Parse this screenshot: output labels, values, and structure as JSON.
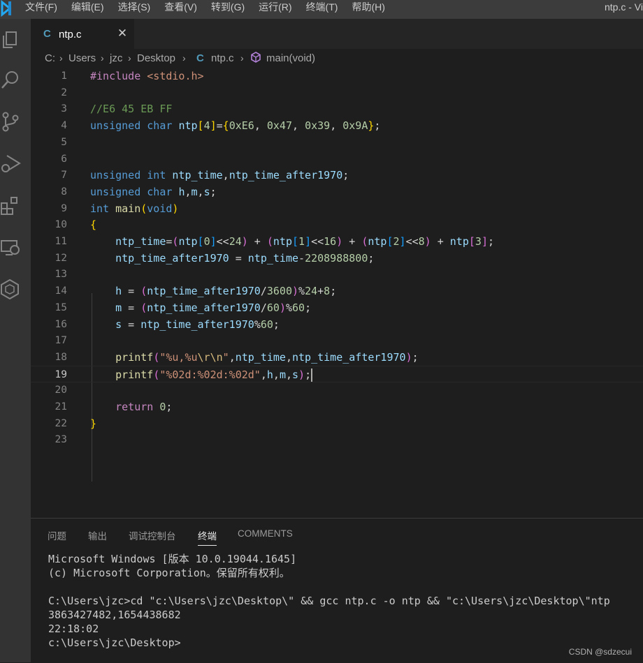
{
  "titlebar": {
    "menu": [
      "文件(F)",
      "编辑(E)",
      "选择(S)",
      "查看(V)",
      "转到(G)",
      "运行(R)",
      "终端(T)",
      "帮助(H)"
    ],
    "window_title": "ntp.c - Vi"
  },
  "activity_icons": [
    "explorer-icon",
    "search-icon",
    "source-control-icon",
    "run-debug-icon",
    "extensions-icon",
    "remote-explorer-icon",
    "cube-icon"
  ],
  "tab": {
    "lang_icon": "C",
    "name": "ntp.c",
    "close": "✕"
  },
  "breadcrumb": [
    "C:",
    "Users",
    "jzc",
    "Desktop",
    "ntp.c",
    "main(void)"
  ],
  "breadcrumb_lang_icon": "C",
  "editor": {
    "line_numbers": [
      "1",
      "2",
      "3",
      "4",
      "5",
      "6",
      "7",
      "8",
      "9",
      "10",
      "11",
      "12",
      "13",
      "14",
      "15",
      "16",
      "17",
      "18",
      "19",
      "20",
      "21",
      "22",
      "23"
    ],
    "current_line": 19,
    "lines": [
      [
        [
          "pp",
          "#include "
        ],
        [
          "str",
          "<stdio.h>"
        ]
      ],
      [],
      [
        [
          "cm",
          "//E6 45 EB FF"
        ]
      ],
      [
        [
          "kw",
          "unsigned char "
        ],
        [
          "vr",
          "ntp"
        ],
        [
          "b1",
          "["
        ],
        [
          "num",
          "4"
        ],
        [
          "b1",
          "]"
        ],
        [
          "pl",
          "="
        ],
        [
          "b1",
          "{"
        ],
        [
          "num",
          "0xE6"
        ],
        [
          "pl",
          ", "
        ],
        [
          "num",
          "0x47"
        ],
        [
          "pl",
          ", "
        ],
        [
          "num",
          "0x39"
        ],
        [
          "pl",
          ", "
        ],
        [
          "num",
          "0x9A"
        ],
        [
          "b1",
          "}"
        ],
        [
          "pl",
          ";"
        ]
      ],
      [],
      [],
      [
        [
          "kw",
          "unsigned int "
        ],
        [
          "vr",
          "ntp_time"
        ],
        [
          "pl",
          ","
        ],
        [
          "vr",
          "ntp_time_after1970"
        ],
        [
          "pl",
          ";"
        ]
      ],
      [
        [
          "kw",
          "unsigned char "
        ],
        [
          "vr",
          "h"
        ],
        [
          "pl",
          ","
        ],
        [
          "vr",
          "m"
        ],
        [
          "pl",
          ","
        ],
        [
          "vr",
          "s"
        ],
        [
          "pl",
          ";"
        ]
      ],
      [
        [
          "kw",
          "int "
        ],
        [
          "fn",
          "main"
        ],
        [
          "b1",
          "("
        ],
        [
          "kw",
          "void"
        ],
        [
          "b1",
          ")"
        ]
      ],
      [
        [
          "b1",
          "{"
        ]
      ],
      [
        [
          "pl",
          "    "
        ],
        [
          "vr",
          "ntp_time"
        ],
        [
          "pl",
          "="
        ],
        [
          "b2",
          "("
        ],
        [
          "vr",
          "ntp"
        ],
        [
          "b3",
          "["
        ],
        [
          "num",
          "0"
        ],
        [
          "b3",
          "]"
        ],
        [
          "pl",
          "<<"
        ],
        [
          "num",
          "24"
        ],
        [
          "b2",
          ")"
        ],
        [
          "pl",
          " + "
        ],
        [
          "b2",
          "("
        ],
        [
          "vr",
          "ntp"
        ],
        [
          "b3",
          "["
        ],
        [
          "num",
          "1"
        ],
        [
          "b3",
          "]"
        ],
        [
          "pl",
          "<<"
        ],
        [
          "num",
          "16"
        ],
        [
          "b2",
          ")"
        ],
        [
          "pl",
          " + "
        ],
        [
          "b2",
          "("
        ],
        [
          "vr",
          "ntp"
        ],
        [
          "b3",
          "["
        ],
        [
          "num",
          "2"
        ],
        [
          "b3",
          "]"
        ],
        [
          "pl",
          "<<"
        ],
        [
          "num",
          "8"
        ],
        [
          "b2",
          ")"
        ],
        [
          "pl",
          " + "
        ],
        [
          "vr",
          "ntp"
        ],
        [
          "b2",
          "["
        ],
        [
          "num",
          "3"
        ],
        [
          "b2",
          "]"
        ],
        [
          "pl",
          ";"
        ]
      ],
      [
        [
          "pl",
          "    "
        ],
        [
          "vr",
          "ntp_time_after1970"
        ],
        [
          "pl",
          " = "
        ],
        [
          "vr",
          "ntp_time"
        ],
        [
          "pl",
          "-"
        ],
        [
          "num",
          "2208988800"
        ],
        [
          "pl",
          ";"
        ]
      ],
      [],
      [
        [
          "pl",
          "    "
        ],
        [
          "vr",
          "h"
        ],
        [
          "pl",
          " = "
        ],
        [
          "b2",
          "("
        ],
        [
          "vr",
          "ntp_time_after1970"
        ],
        [
          "pl",
          "/"
        ],
        [
          "num",
          "3600"
        ],
        [
          "b2",
          ")"
        ],
        [
          "pl",
          "%"
        ],
        [
          "num",
          "24"
        ],
        [
          "pl",
          "+"
        ],
        [
          "num",
          "8"
        ],
        [
          "pl",
          ";"
        ]
      ],
      [
        [
          "pl",
          "    "
        ],
        [
          "vr",
          "m"
        ],
        [
          "pl",
          " = "
        ],
        [
          "b2",
          "("
        ],
        [
          "vr",
          "ntp_time_after1970"
        ],
        [
          "pl",
          "/"
        ],
        [
          "num",
          "60"
        ],
        [
          "b2",
          ")"
        ],
        [
          "pl",
          "%"
        ],
        [
          "num",
          "60"
        ],
        [
          "pl",
          ";"
        ]
      ],
      [
        [
          "pl",
          "    "
        ],
        [
          "vr",
          "s"
        ],
        [
          "pl",
          " = "
        ],
        [
          "vr",
          "ntp_time_after1970"
        ],
        [
          "pl",
          "%"
        ],
        [
          "num",
          "60"
        ],
        [
          "pl",
          ";"
        ]
      ],
      [],
      [
        [
          "pl",
          "    "
        ],
        [
          "fn",
          "printf"
        ],
        [
          "b2",
          "("
        ],
        [
          "str",
          "\"%u,%u"
        ],
        [
          "esc",
          "\\r\\n"
        ],
        [
          "str",
          "\""
        ],
        [
          "pl",
          ","
        ],
        [
          "vr",
          "ntp_time"
        ],
        [
          "pl",
          ","
        ],
        [
          "vr",
          "ntp_time_after1970"
        ],
        [
          "b2",
          ")"
        ],
        [
          "pl",
          ";"
        ]
      ],
      [
        [
          "pl",
          "    "
        ],
        [
          "fn",
          "printf"
        ],
        [
          "b2",
          "("
        ],
        [
          "str",
          "\"%02d:%02d:%02d\""
        ],
        [
          "pl",
          ","
        ],
        [
          "vr",
          "h"
        ],
        [
          "pl",
          ","
        ],
        [
          "vr",
          "m"
        ],
        [
          "pl",
          ","
        ],
        [
          "vr",
          "s"
        ],
        [
          "b2",
          ")"
        ],
        [
          "pl",
          ";"
        ],
        [
          "cursor",
          ""
        ]
      ],
      [],
      [
        [
          "pl",
          "    "
        ],
        [
          "pp",
          "return "
        ],
        [
          "num",
          "0"
        ],
        [
          "pl",
          ";"
        ]
      ],
      [
        [
          "b1",
          "}"
        ]
      ],
      []
    ]
  },
  "panel": {
    "tabs": [
      "问题",
      "输出",
      "调试控制台",
      "终端",
      "COMMENTS"
    ],
    "active_tab": "终端",
    "terminal_lines": [
      "Microsoft Windows [版本 10.0.19044.1645]",
      "(c) Microsoft Corporation。保留所有权利。",
      "",
      "C:\\Users\\jzc>cd \"c:\\Users\\jzc\\Desktop\\\" && gcc ntp.c -o ntp && \"c:\\Users\\jzc\\Desktop\\\"ntp",
      "3863427482,1654438682",
      "22:18:02",
      "c:\\Users\\jzc\\Desktop>"
    ]
  },
  "watermark": "CSDN @sdzecui"
}
